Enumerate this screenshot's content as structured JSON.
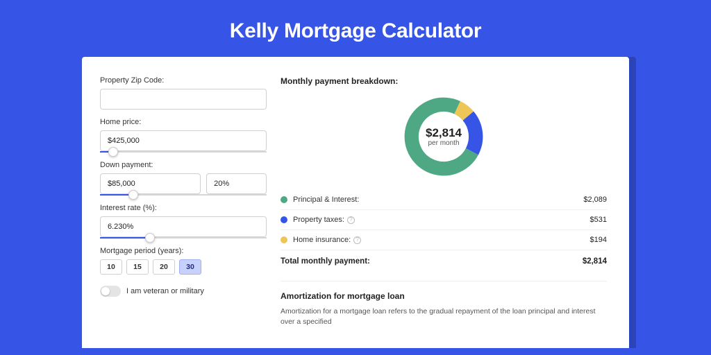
{
  "title": "Kelly Mortgage Calculator",
  "form": {
    "zip_label": "Property Zip Code:",
    "zip_value": "",
    "home_price_label": "Home price:",
    "home_price_value": "$425,000",
    "home_price_slider_pct": 8,
    "down_payment_label": "Down payment:",
    "down_payment_amount": "$85,000",
    "down_payment_pct": "20%",
    "down_payment_slider_pct": 20,
    "interest_label": "Interest rate (%):",
    "interest_value": "6.230%",
    "interest_slider_pct": 30,
    "term_label": "Mortgage period (years):",
    "terms": [
      "10",
      "15",
      "20",
      "30"
    ],
    "term_selected_index": 3,
    "veteran_label": "I am veteran or military",
    "veteran_checked": false
  },
  "breakdown": {
    "title": "Monthly payment breakdown:",
    "center_amount": "$2,814",
    "center_sub": "per month",
    "items": [
      {
        "label": "Principal & Interest:",
        "value": "$2,089",
        "color": "#4ea884",
        "help": false
      },
      {
        "label": "Property taxes:",
        "value": "$531",
        "color": "#3654e6",
        "help": true
      },
      {
        "label": "Home insurance:",
        "value": "$194",
        "color": "#ecc656",
        "help": true
      }
    ],
    "total_label": "Total monthly payment:",
    "total_value": "$2,814"
  },
  "amortization": {
    "title": "Amortization for mortgage loan",
    "text": "Amortization for a mortgage loan refers to the gradual repayment of the loan principal and interest over a specified"
  },
  "chart_data": {
    "type": "pie",
    "title": "Monthly payment breakdown",
    "series": [
      {
        "name": "Principal & Interest",
        "value": 2089,
        "color": "#4ea884"
      },
      {
        "name": "Property taxes",
        "value": 531,
        "color": "#3654e6"
      },
      {
        "name": "Home insurance",
        "value": 194,
        "color": "#ecc656"
      }
    ],
    "total": 2814,
    "unit": "USD per month"
  }
}
